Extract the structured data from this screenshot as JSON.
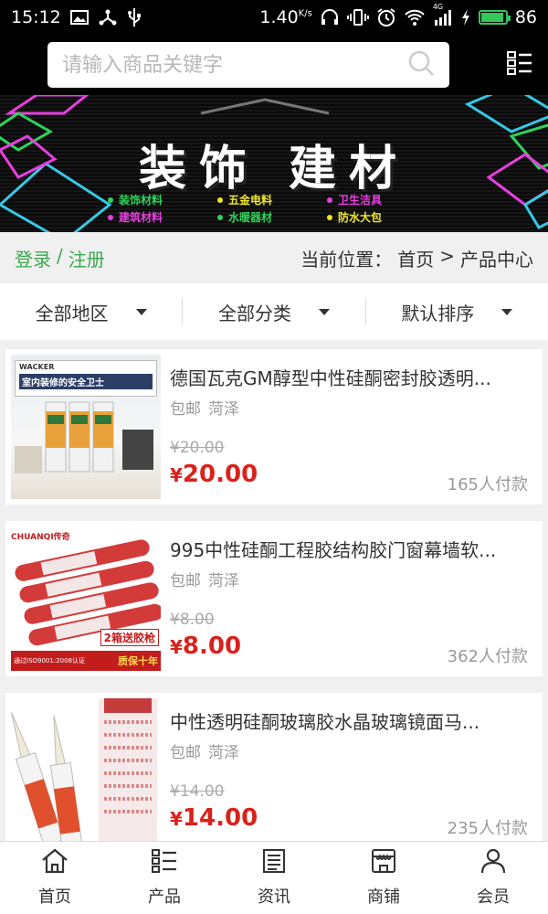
{
  "status_bar": {
    "time": "15:12",
    "speed": "1.40",
    "speed_unit": "K/s",
    "network": "4G",
    "battery": "86",
    "battery_level": 0.86
  },
  "search": {
    "placeholder": "请输入商品关键字"
  },
  "banner": {
    "title": "装饰 建材",
    "items": [
      {
        "label": "装饰材料",
        "color": "#2fd35b"
      },
      {
        "label": "五金电料",
        "color": "#f0e62e"
      },
      {
        "label": "卫生洁具",
        "color": "#e83fe0"
      },
      {
        "label": "建筑材料",
        "color": "#e83fe0"
      },
      {
        "label": "水暖器材",
        "color": "#2fd35b"
      },
      {
        "label": "防水大包",
        "color": "#f0e62e"
      }
    ]
  },
  "auth": {
    "login": "登录",
    "separator": "/",
    "register": "注册"
  },
  "location": {
    "label": "当前位置：",
    "home": "首页",
    "arrow": ">",
    "current": "产品中心"
  },
  "filters": [
    {
      "label": "全部地区"
    },
    {
      "label": "全部分类"
    },
    {
      "label": "默认排序"
    }
  ],
  "products": [
    {
      "title": "德国瓦克GM醇型中性硅酮密封胶透明...",
      "shipping": "包邮",
      "city": "菏泽",
      "old_price": "¥20.00",
      "price_symbol": "¥",
      "price": "20.00",
      "sold": "165人付款",
      "thumb_brand": "WACKER",
      "thumb_slogan": "室内装修的安全卫士"
    },
    {
      "title": "995中性硅酮工程胶结构胶门窗幕墙软...",
      "shipping": "包邮",
      "city": "菏泽",
      "old_price": "¥8.00",
      "price_symbol": "¥",
      "price": "8.00",
      "sold": "362人付款",
      "thumb_brand": "CHUANQI传奇",
      "thumb_promo": "2箱送胶枪",
      "thumb_cert": "通过ISO9001:2008认证",
      "thumb_warranty": "质保十年"
    },
    {
      "title": "中性透明硅酮玻璃胶水晶玻璃镜面马...",
      "shipping": "包邮",
      "city": "菏泽",
      "old_price": "¥14.00",
      "price_symbol": "¥",
      "price": "14.00",
      "sold": "235人付款"
    }
  ],
  "bottom_nav": [
    {
      "label": "首页",
      "icon": "home-icon"
    },
    {
      "label": "产品",
      "icon": "grid-list-icon"
    },
    {
      "label": "资讯",
      "icon": "news-icon"
    },
    {
      "label": "商铺",
      "icon": "shop-icon"
    },
    {
      "label": "会员",
      "icon": "user-icon"
    }
  ],
  "colors": {
    "accent_green": "#3aa84f",
    "price_red": "#d9221c"
  }
}
